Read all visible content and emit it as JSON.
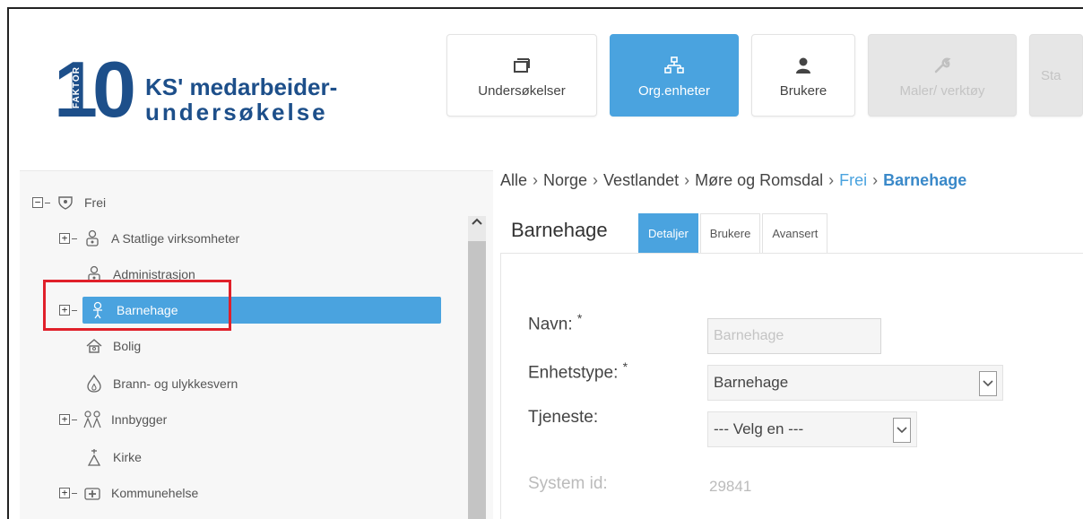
{
  "logo": {
    "number": "10",
    "faktor": "FAKTOR",
    "line1": "KS' medarbeider-",
    "line2": "undersøkelse"
  },
  "topnav": {
    "items": [
      {
        "label": "Undersøkelser",
        "icon": "window-icon",
        "state": "normal"
      },
      {
        "label": "Org.enheter",
        "icon": "org-chart-icon",
        "state": "active"
      },
      {
        "label": "Brukere",
        "icon": "user-icon",
        "state": "normal"
      },
      {
        "label": "Maler/ verktøy",
        "icon": "wrench-icon",
        "state": "disabled"
      },
      {
        "label": "Sta",
        "icon": "",
        "state": "disabled"
      }
    ]
  },
  "tree": {
    "root": {
      "label": "Frei",
      "icon": "shield-icon"
    },
    "items": [
      {
        "label": "A Statlige virksomheter",
        "icon": "person-group-icon",
        "expandable": true
      },
      {
        "label": "Administrasjon",
        "icon": "person-group-icon",
        "expandable": false
      },
      {
        "label": "Barnehage",
        "icon": "child-icon",
        "expandable": true,
        "selected": true
      },
      {
        "label": "Bolig",
        "icon": "house-icon",
        "expandable": false
      },
      {
        "label": "Brann- og ulykkesvern",
        "icon": "fire-icon",
        "expandable": false
      },
      {
        "label": "Innbygger",
        "icon": "people-icon",
        "expandable": true
      },
      {
        "label": "Kirke",
        "icon": "church-icon",
        "expandable": false
      },
      {
        "label": "Kommunehelse",
        "icon": "health-icon",
        "expandable": true
      }
    ]
  },
  "breadcrumb": {
    "items": [
      "Alle",
      "Norge",
      "Vestlandet",
      "Møre og Romsdal",
      "Frei",
      "Barnehage"
    ],
    "separator": "›"
  },
  "detail": {
    "title": "Barnehage",
    "tabs": [
      "Detaljer",
      "Brukere",
      "Avansert"
    ],
    "fields": {
      "navn_label": "Navn:",
      "navn_value": "Barnehage",
      "enhetstype_label": "Enhetstype:",
      "enhetstype_value": "Barnehage",
      "tjeneste_label": "Tjeneste:",
      "tjeneste_value": "--- Velg en ---",
      "system_id_label": "System id:",
      "system_id_value": "29841",
      "required_mark": "*"
    }
  },
  "colors": {
    "accent": "#4aa3df",
    "brand": "#1d4f8a",
    "highlight": "#e0202a"
  }
}
